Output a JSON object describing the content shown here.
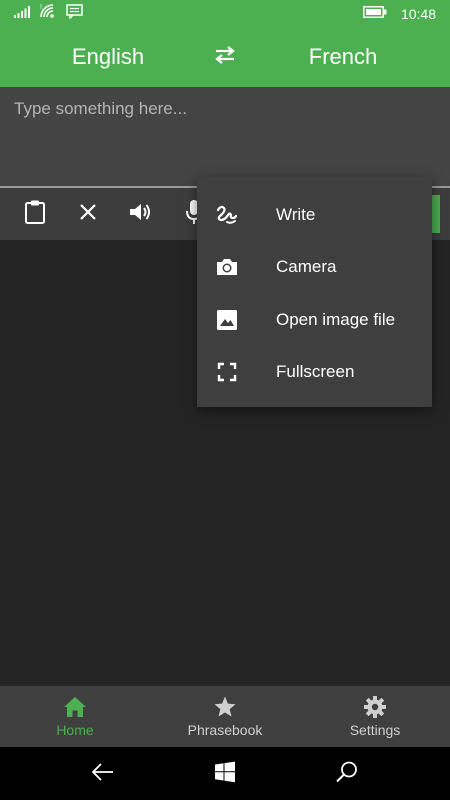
{
  "status_bar": {
    "time": "10:48",
    "icons": [
      "signal-icon",
      "wifi-icon",
      "message-icon",
      "battery-icon"
    ]
  },
  "header": {
    "source_language": "English",
    "target_language": "French",
    "swap_icon": "swap-arrows-icon"
  },
  "input": {
    "placeholder": "Type something here...",
    "value": ""
  },
  "toolbar": {
    "icons": [
      "clipboard-icon",
      "clear-icon",
      "speaker-icon",
      "microphone-icon"
    ]
  },
  "menu": {
    "items": [
      {
        "label": "Write",
        "icon": "handwriting-icon"
      },
      {
        "label": "Camera",
        "icon": "camera-icon"
      },
      {
        "label": "Open image file",
        "icon": "image-icon"
      },
      {
        "label": "Fullscreen",
        "icon": "fullscreen-icon"
      }
    ]
  },
  "bottom_nav": {
    "items": [
      {
        "label": "Home",
        "icon": "home-icon",
        "active": true
      },
      {
        "label": "Phrasebook",
        "icon": "star-icon",
        "active": false
      },
      {
        "label": "Settings",
        "icon": "gear-icon",
        "active": false
      }
    ]
  },
  "system_nav": {
    "icons": [
      "back-icon",
      "windows-icon",
      "search-icon"
    ]
  },
  "colors": {
    "accent": "#4caf50",
    "background": "#242424",
    "surface": "#3f3f3f",
    "input_background": "#444444"
  }
}
